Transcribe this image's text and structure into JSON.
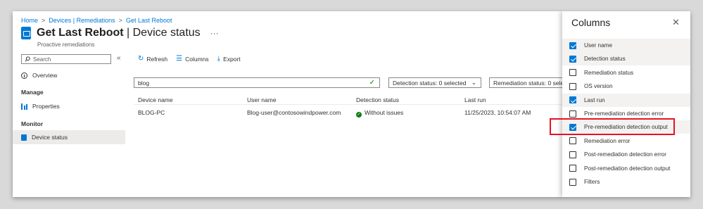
{
  "breadcrumb": [
    "Home",
    "Devices | Remediations",
    "Get Last Reboot"
  ],
  "header": {
    "title": "Get Last Reboot",
    "title_suffix": "Device status",
    "more": "···",
    "subtitle": "Proactive remediations"
  },
  "sidebar": {
    "search_placeholder": "Search",
    "collapse": "«",
    "overview": "Overview",
    "manage_header": "Manage",
    "properties": "Properties",
    "monitor_header": "Monitor",
    "device_status": "Device status"
  },
  "toolbar": {
    "refresh": "Refresh",
    "columns": "Columns",
    "export": "Export"
  },
  "filter": {
    "value": "blog",
    "detection_dropdown": "Detection status: 0 selected",
    "remediation_dropdown": "Remediation status: 0 selected"
  },
  "table": {
    "headers": [
      "Device name",
      "User name",
      "Detection status",
      "Last run"
    ],
    "rows": [
      {
        "device": "BLOG-PC",
        "user": "Blog-user@contosowindpower.com",
        "detection": "Without issues",
        "last_run": "11/25/2023, 10:54:07 AM"
      }
    ]
  },
  "columns_panel": {
    "title": "Columns",
    "close": "✕",
    "items": [
      {
        "label": "User name",
        "checked": true
      },
      {
        "label": "Detection status",
        "checked": true
      },
      {
        "label": "Remediation status",
        "checked": false
      },
      {
        "label": "OS version",
        "checked": false
      },
      {
        "label": "Last run",
        "checked": true
      },
      {
        "label": "Pre-remediation detection error",
        "checked": false
      },
      {
        "label": "Pre-remediation detection output",
        "checked": true
      },
      {
        "label": "Remediation error",
        "checked": false
      },
      {
        "label": "Post-remediation detection error",
        "checked": false
      },
      {
        "label": "Post-remediation detection output",
        "checked": false
      },
      {
        "label": "Filters",
        "checked": false
      }
    ]
  },
  "colors": {
    "accent": "#0078d4",
    "success": "#107c10",
    "highlight": "#e81123"
  }
}
